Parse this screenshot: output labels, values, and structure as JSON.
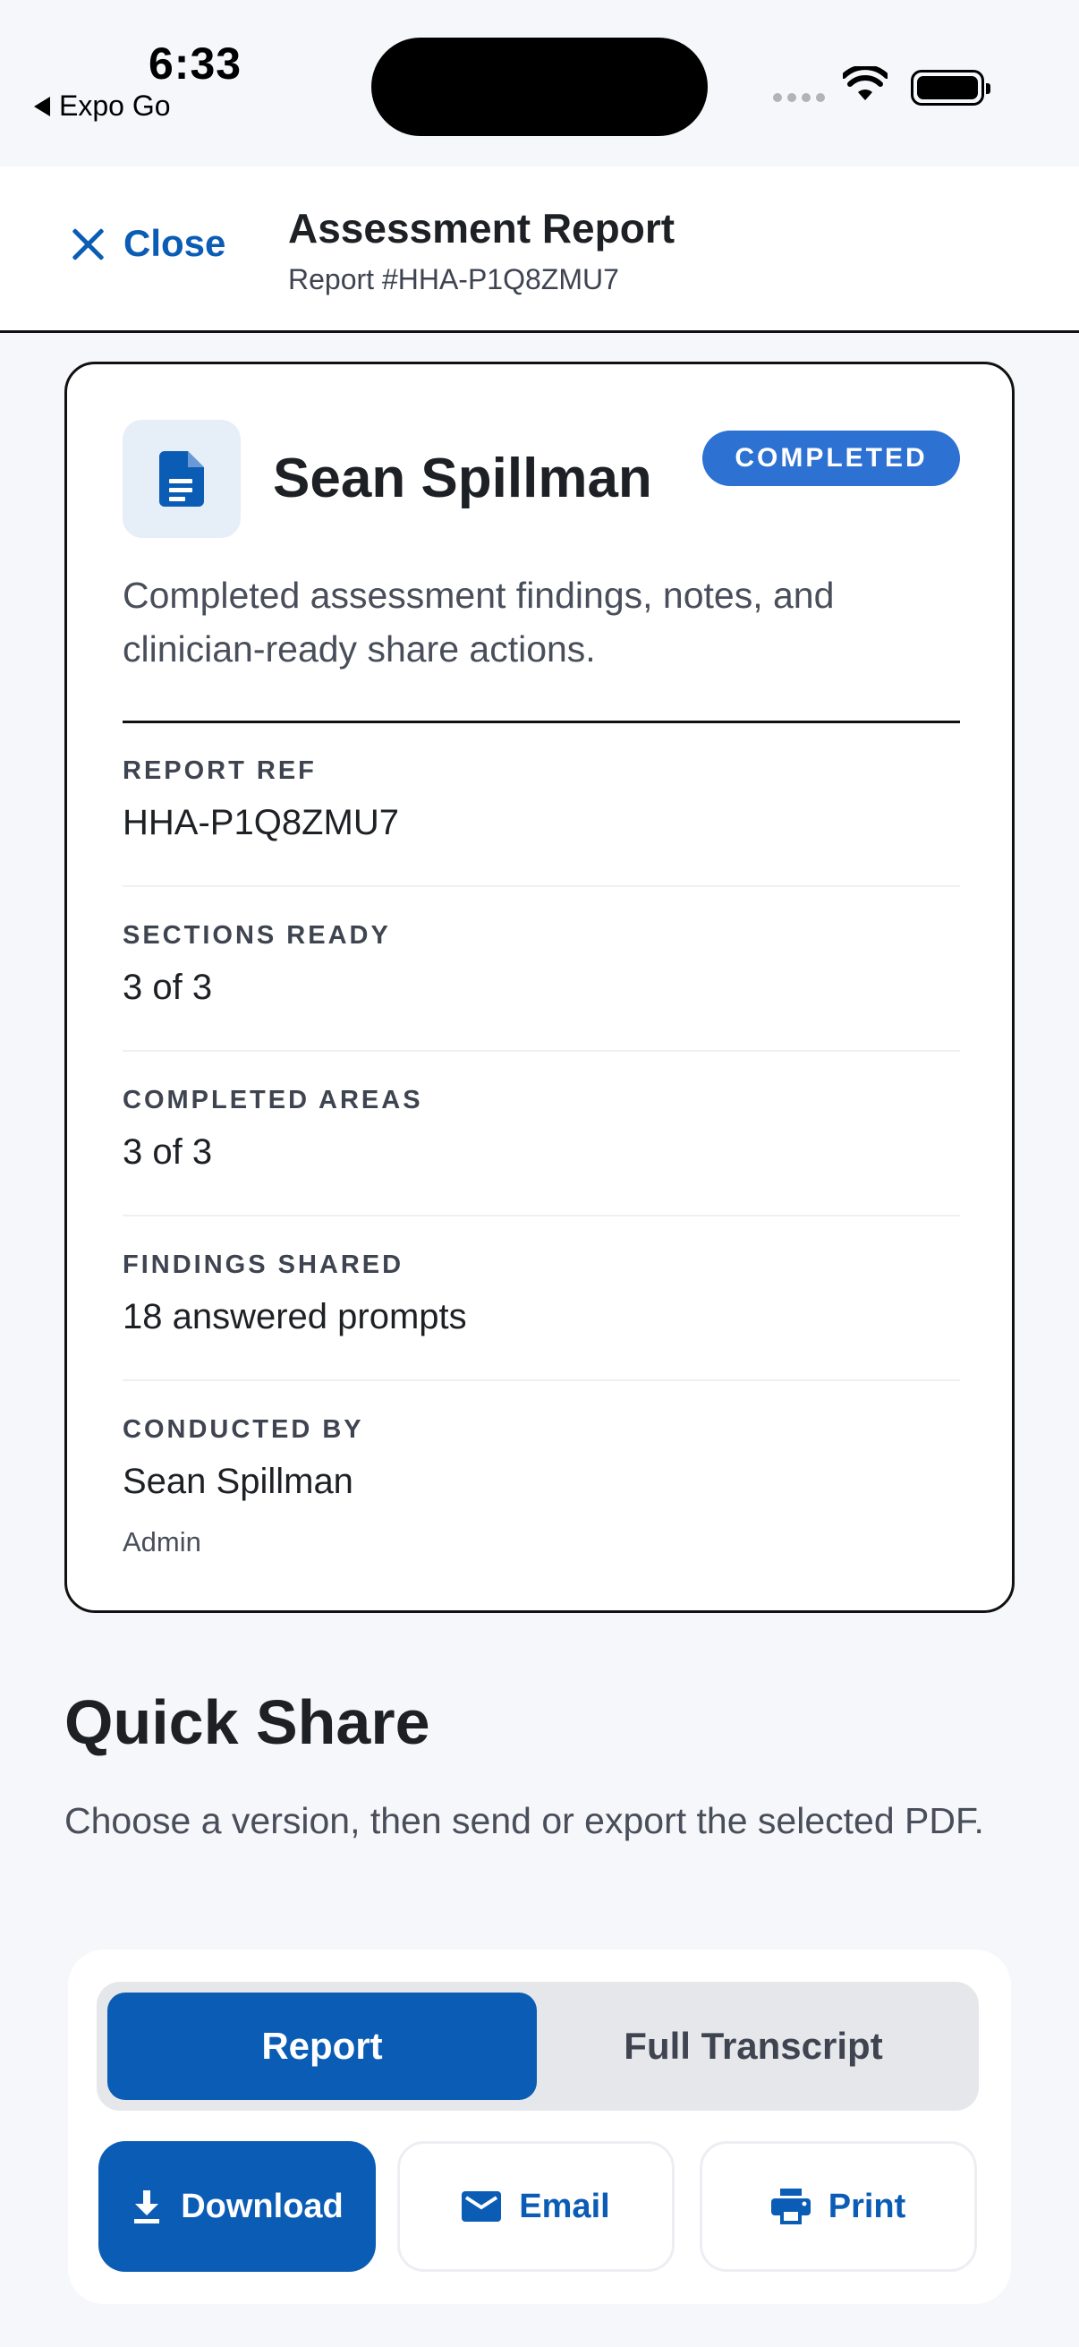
{
  "status_bar": {
    "time": "6:33",
    "back_app": "Expo Go"
  },
  "header": {
    "close_label": "Close",
    "title": "Assessment Report",
    "subtitle": "Report #HHA-P1Q8ZMU7"
  },
  "card": {
    "patient_name": "Sean Spillman",
    "status": "COMPLETED",
    "description": "Completed assessment findings, notes, and clinician-ready share actions.",
    "fields": [
      {
        "label": "REPORT REF",
        "value": "HHA-P1Q8ZMU7"
      },
      {
        "label": "SECTIONS READY",
        "value": "3 of 3"
      },
      {
        "label": "COMPLETED AREAS",
        "value": "3 of 3"
      },
      {
        "label": "FINDINGS SHARED",
        "value": "18 answered prompts"
      },
      {
        "label": "CONDUCTED BY",
        "value": "Sean Spillman",
        "role": "Admin"
      }
    ]
  },
  "quick_share": {
    "title": "Quick Share",
    "description": "Choose a version, then send or export the selected PDF.",
    "versions": [
      {
        "label": "Report",
        "selected": true
      },
      {
        "label": "Full Transcript",
        "selected": false
      }
    ],
    "actions": {
      "download": "Download",
      "email": "Email",
      "print": "Print"
    }
  },
  "icons": {
    "close": "close-icon",
    "document": "document-icon",
    "download": "download-icon",
    "email": "mail-icon",
    "print": "printer-icon"
  },
  "colors": {
    "accent": "#0b5cb5",
    "status_pill": "#2d71d2",
    "background": "#f6f7fa"
  }
}
